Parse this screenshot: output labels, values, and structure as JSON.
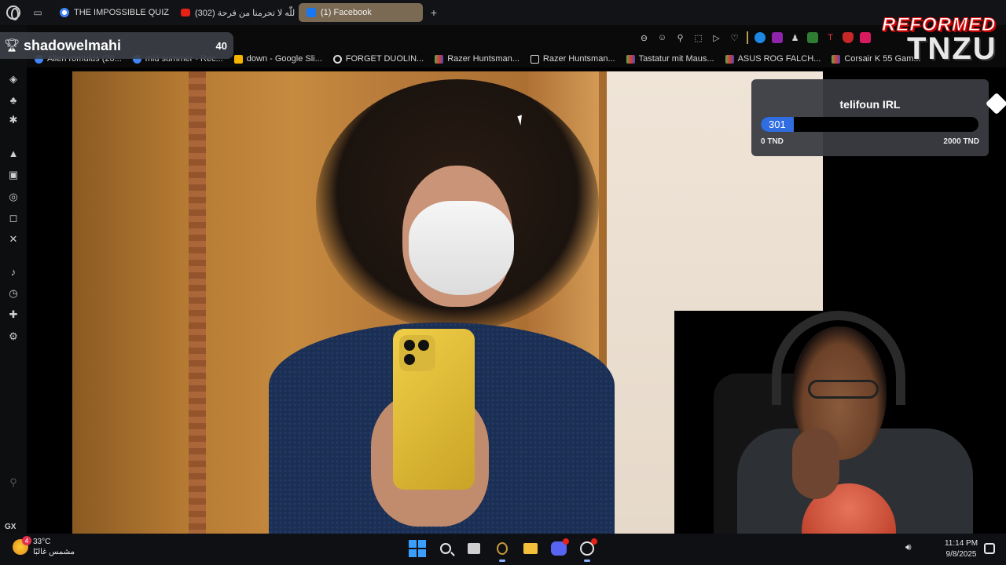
{
  "browser": {
    "tabs": [
      {
        "label": "THE IMPOSSIBLE QUIZ - |",
        "favicon": "google-icon",
        "active": false
      },
      {
        "label": "اللّٰه لا تحرمنا من فرحة (302)",
        "favicon": "youtube-icon",
        "active": false
      },
      {
        "label": "(1) Facebook",
        "favicon": "facebook-icon",
        "active": true
      }
    ],
    "new_tab_symbol": "+",
    "bookmarks": [
      {
        "label": "Alien romulus (20...",
        "icon": "google-icon"
      },
      {
        "label": "mid summer - Rec...",
        "icon": "google-icon"
      },
      {
        "label": "down - Google Sli...",
        "icon": "slides-icon"
      },
      {
        "label": "FORGET DUOLIN...",
        "icon": "link-icon"
      },
      {
        "label": "Razer Huntsman...",
        "icon": "flag-icon"
      },
      {
        "label": "Razer Huntsman...",
        "icon": "page-icon"
      },
      {
        "label": "Tastatur mit Maus...",
        "icon": "flag-icon"
      },
      {
        "label": "ASUS ROG FALCH...",
        "icon": "flag-icon"
      },
      {
        "label": "Corsair K 55 Gam...",
        "icon": "flag-icon"
      }
    ],
    "sidebar_gx_label": "GX",
    "sidebar_more": "..."
  },
  "overlay": {
    "viewer_name": "shadowelmahi",
    "viewer_count": "40",
    "brand_line1": "REFORMED",
    "brand_line2": "TNZU",
    "widget": {
      "title": "telifoun IRL",
      "current_label": "301",
      "min_label": "0 TND",
      "max_label": "2000 TND",
      "progress_value": 301,
      "progress_max": 2000,
      "fill_color": "#2f6de0"
    }
  },
  "taskbar": {
    "weather_temp": "33°C",
    "weather_desc": "مشمس غالبًا",
    "weather_badge": "4",
    "time": "11:14 PM",
    "date": "9/8/2025"
  }
}
